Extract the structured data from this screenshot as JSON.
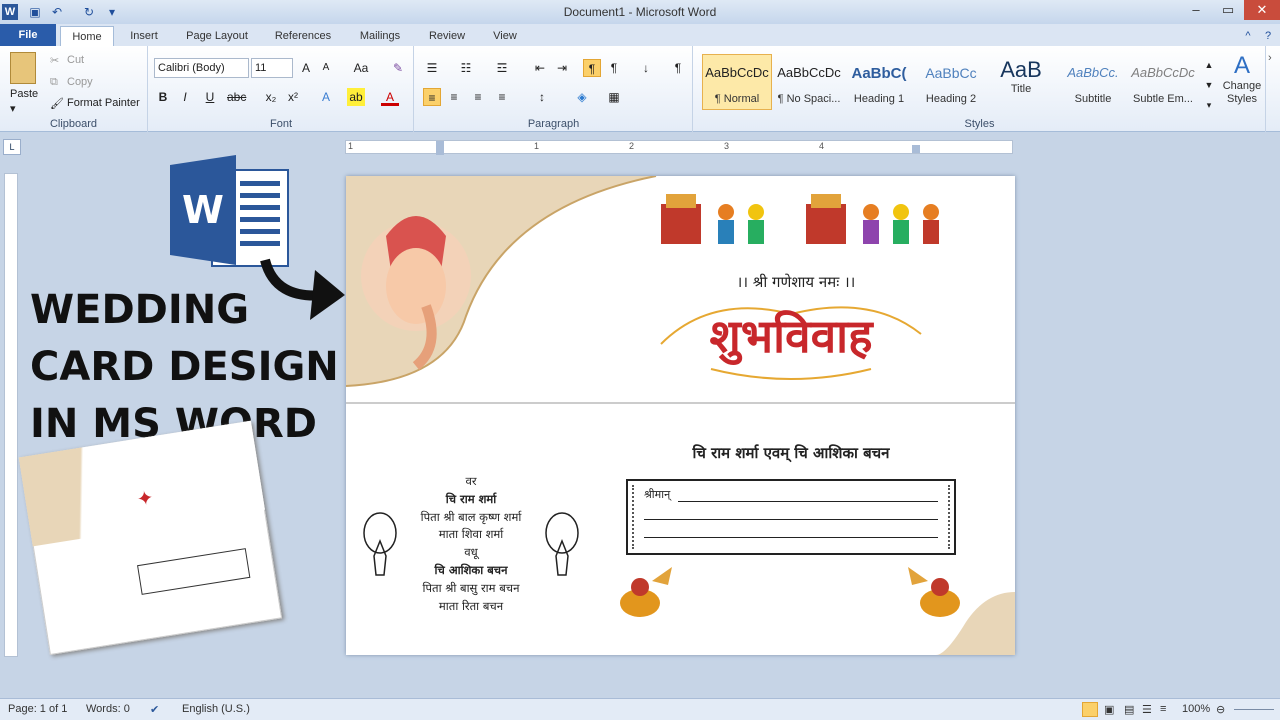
{
  "window": {
    "title": "Document1 - Microsoft Word"
  },
  "tabs": [
    "File",
    "Home",
    "Insert",
    "Page Layout",
    "References",
    "Mailings",
    "Review",
    "View"
  ],
  "clipboard": {
    "paste": "Paste",
    "cut": "Cut",
    "copy": "Copy",
    "format_painter": "Format Painter",
    "label": "Clipboard"
  },
  "font": {
    "name": "Calibri (Body)",
    "size": "11",
    "label": "Font"
  },
  "paragraph": {
    "label": "Paragraph"
  },
  "styles": {
    "label": "Styles",
    "items": [
      {
        "preview": "AaBbCcDc",
        "name": "¶ Normal"
      },
      {
        "preview": "AaBbCcDc",
        "name": "¶ No Spaci..."
      },
      {
        "preview": "AaBbC(",
        "name": "Heading 1"
      },
      {
        "preview": "AaBbCc",
        "name": "Heading 2"
      },
      {
        "preview": "AaB",
        "name": "Title"
      },
      {
        "preview": "AaBbCc.",
        "name": "Subtitle"
      },
      {
        "preview": "AaBbCcDc",
        "name": "Subtle Em..."
      }
    ],
    "change": "Change Styles"
  },
  "ruler": [
    "1",
    "1",
    "2",
    "3",
    "4"
  ],
  "promo": {
    "line1": "WEDDING",
    "line2": "CARD DESIGN",
    "line3": "IN MS WORD"
  },
  "card": {
    "invocation": "।। श्री गणेशाय नमः ।।",
    "headline": "शुभविवाह",
    "couple": "चि राम शर्मा एवम् चि आशिका बचन",
    "groom_label": "वर",
    "groom_name": "चि राम शर्मा",
    "groom_father": "पिता श्री बाल कृष्ण शर्मा",
    "groom_mother": "माता शिवा शर्मा",
    "bride_label": "वधू",
    "bride_name": "चि आशिका बचन",
    "bride_father": "पिता श्री बासु राम बचन",
    "bride_mother": "माता रिता बचन",
    "addressee": "श्रीमान्"
  },
  "status": {
    "page": "Page: 1 of 1",
    "words": "Words: 0",
    "language": "English (U.S.)",
    "zoom": "100%"
  },
  "colors": {
    "file_tab": "#2a5caa",
    "headline": "#c8272b",
    "card_tan": "#e8d6b8",
    "word_blue": "#2b579a"
  }
}
